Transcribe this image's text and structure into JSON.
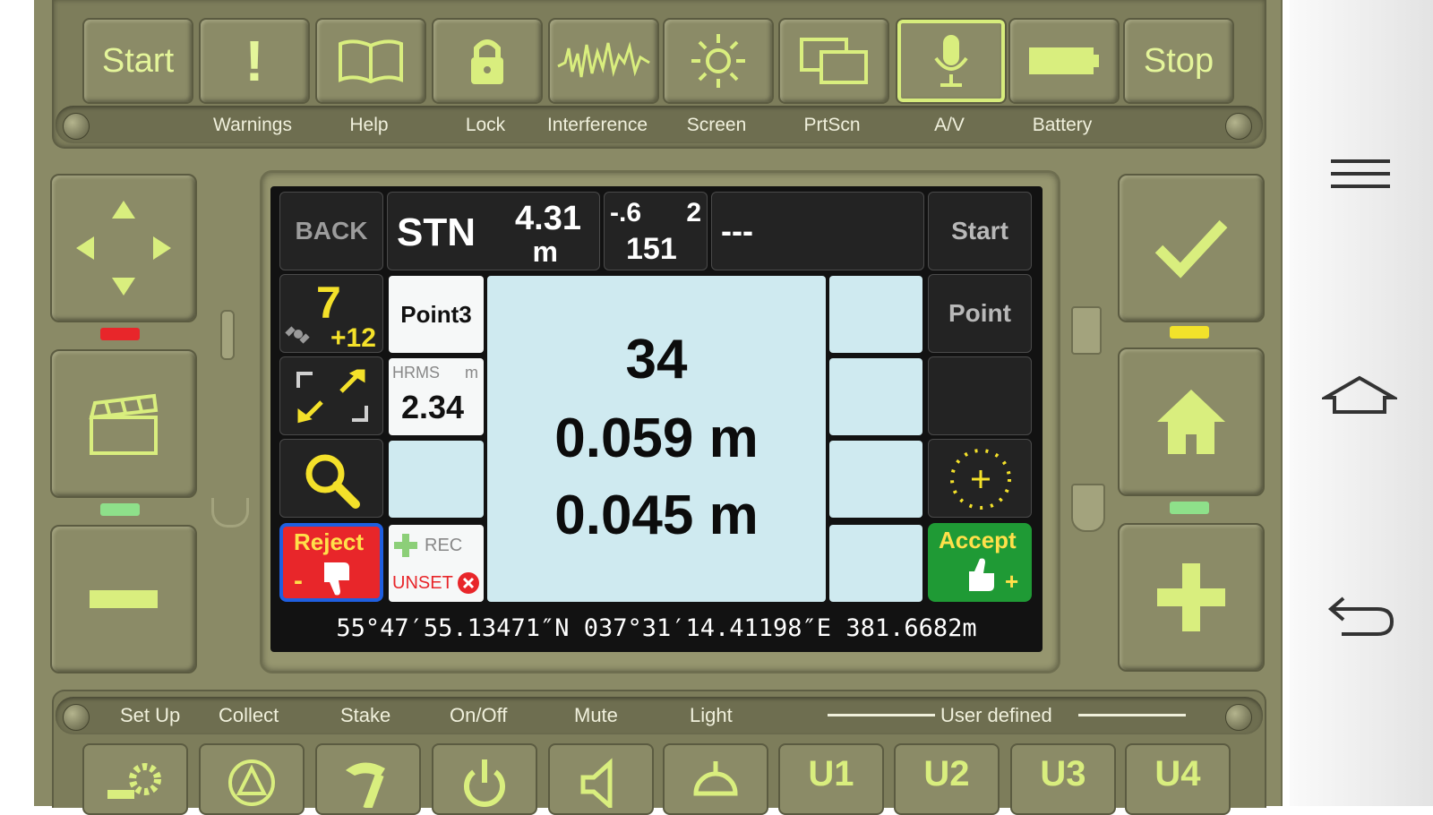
{
  "top_toolbar": {
    "buttons": [
      {
        "name": "start",
        "text": "Start",
        "label": ""
      },
      {
        "name": "warnings",
        "text": "",
        "label": "Warnings"
      },
      {
        "name": "help",
        "text": "",
        "label": "Help"
      },
      {
        "name": "lock",
        "text": "",
        "label": "Lock"
      },
      {
        "name": "interference",
        "text": "",
        "label": "Interference"
      },
      {
        "name": "screen",
        "text": "",
        "label": "Screen"
      },
      {
        "name": "prtscn",
        "text": "",
        "label": "PrtScn"
      },
      {
        "name": "av",
        "text": "",
        "label": "A/V"
      },
      {
        "name": "battery",
        "text": "",
        "label": "Battery"
      },
      {
        "name": "stop",
        "text": "Stop",
        "label": ""
      }
    ]
  },
  "screen": {
    "back": "BACK",
    "stn_label": "STN",
    "stn_value": "4.31",
    "stn_unit": "m",
    "coord_top_left": "-.6",
    "coord_top_right": "2",
    "coord_bottom": "151",
    "status": "---",
    "start": "Start",
    "satellites": "7",
    "satellites_extra": "+12",
    "point_name": "Point3",
    "hrms_label": "HRMS",
    "hrms_unit": "m",
    "hrms_value": "2.34",
    "rec_label": "REC",
    "unset_label": "UNSET",
    "main_value_1": "34",
    "main_value_2": "0.059 m",
    "main_value_3": "0.045 m",
    "point_button": "Point",
    "reject_label": "Reject",
    "reject_sign": "-",
    "accept_label": "Accept",
    "accept_sign": "+",
    "coordinates": "55°47′55.13471″N 037°31′14.41198″E 381.6682m"
  },
  "bottom_toolbar": {
    "labels": [
      "Set Up",
      "Collect",
      "Stake",
      "On/Off",
      "Mute",
      "Light"
    ],
    "user_defined": "User defined",
    "user_buttons": [
      "U1",
      "U2",
      "U3",
      "U4"
    ]
  },
  "colors": {
    "panel": "#8a8a66",
    "accent": "#d9ee7e",
    "reject": "#e8262a",
    "accept": "#1f9a35",
    "screen_bg": "#cfeaf0"
  }
}
